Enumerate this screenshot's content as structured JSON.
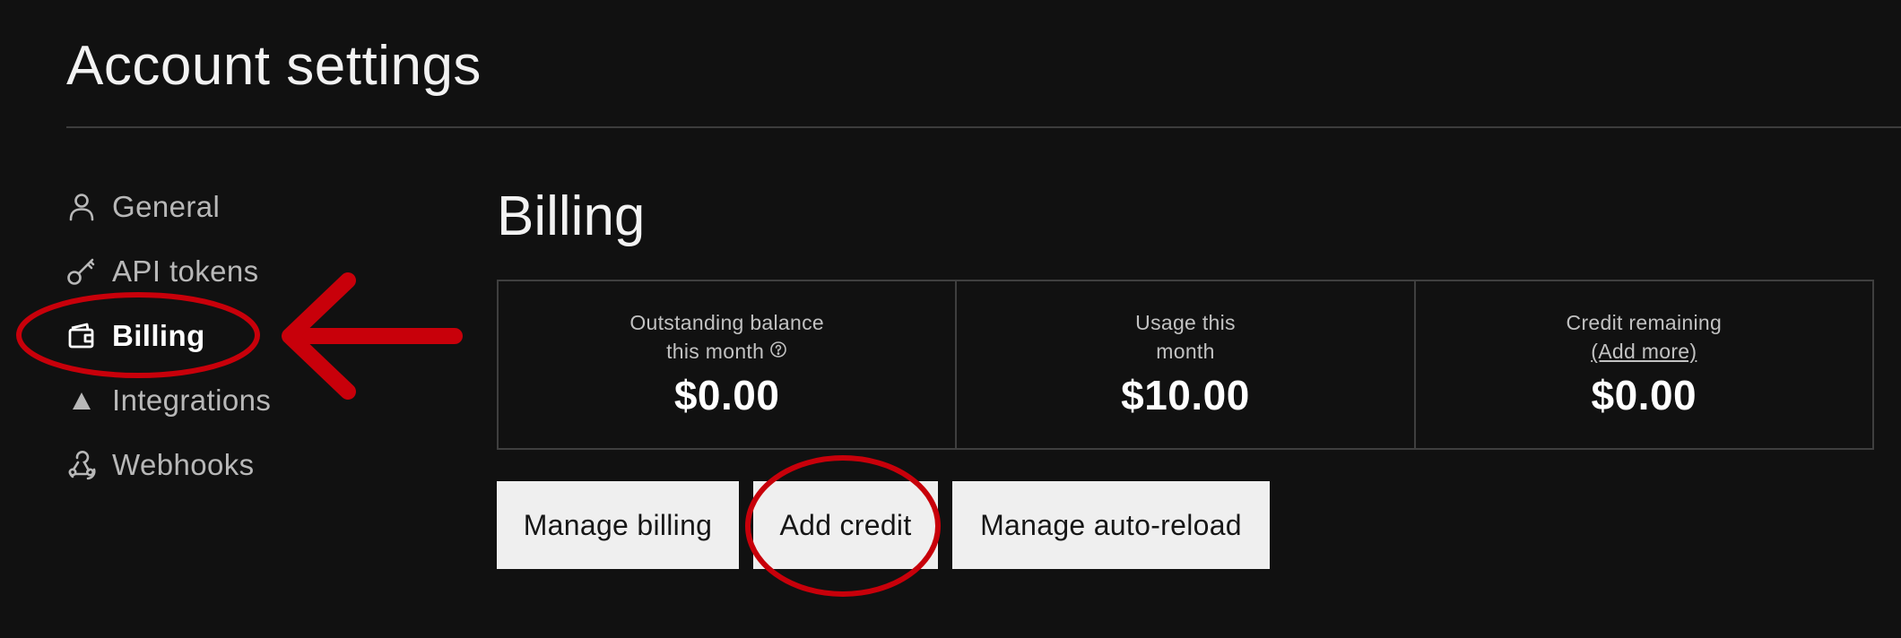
{
  "header": {
    "title": "Account settings"
  },
  "sidebar": {
    "items": [
      {
        "label": "General",
        "icon": "user-icon",
        "active": false
      },
      {
        "label": "API tokens",
        "icon": "key-icon",
        "active": false
      },
      {
        "label": "Billing",
        "icon": "wallet-icon",
        "active": true
      },
      {
        "label": "Integrations",
        "icon": "triangle-icon",
        "active": false
      },
      {
        "label": "Webhooks",
        "icon": "webhook-icon",
        "active": false
      }
    ]
  },
  "main": {
    "heading": "Billing",
    "stats": [
      {
        "label_line1": "Outstanding balance",
        "label_line2": "this month",
        "value": "$0.00",
        "help_icon": "question-circle-icon"
      },
      {
        "label_line1": "Usage this",
        "label_line2": "month",
        "value": "$10.00"
      },
      {
        "label_line1": "Credit remaining",
        "link": "(Add more)",
        "value": "$0.00"
      }
    ],
    "buttons": {
      "manage_billing": "Manage billing",
      "add_credit": "Add credit",
      "manage_auto_reload": "Manage auto-reload"
    }
  },
  "annotations": {
    "color": "#c8000a",
    "highlights": [
      "sidebar-item-billing",
      "add-credit-button"
    ]
  },
  "colors": {
    "background": "#111111",
    "button_bg": "#efefef",
    "border": "#3f3f3f",
    "text_muted": "#b8b8b8"
  }
}
